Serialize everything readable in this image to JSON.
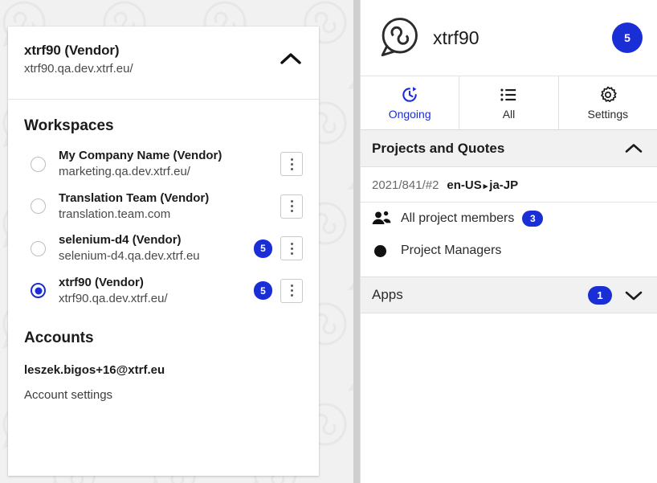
{
  "background": {
    "watermark_icon": "speech-bubble-infinity-logo",
    "color": "#f1f1f1"
  },
  "account_panel": {
    "current": {
      "name": "xtrf90 (Vendor)",
      "url": "xtrf90.qa.dev.xtrf.eu/",
      "collapse_icon": "chevron-up-icon"
    },
    "workspaces_heading": "Workspaces",
    "workspaces": [
      {
        "name": "My Company Name (Vendor)",
        "url": "marketing.qa.dev.xtrf.eu/",
        "selected": false,
        "badge": "",
        "menu_icon": "kebab-menu-icon"
      },
      {
        "name": "Translation Team (Vendor)",
        "url": "translation.team.com",
        "selected": false,
        "badge": "",
        "menu_icon": "kebab-menu-icon"
      },
      {
        "name": "selenium-d4 (Vendor)",
        "url": "selenium-d4.qa.dev.xtrf.eu",
        "selected": false,
        "badge": "5",
        "menu_icon": "kebab-menu-icon"
      },
      {
        "name": "xtrf90 (Vendor)",
        "url": "xtrf90.qa.dev.xtrf.eu/",
        "selected": true,
        "badge": "5",
        "menu_icon": "kebab-menu-icon"
      }
    ],
    "accounts_heading": "Accounts",
    "account_email": "leszek.bigos+16@xtrf.eu",
    "account_settings_label": "Account settings"
  },
  "right_panel": {
    "logo_icon": "speech-bubble-infinity-logo",
    "title": "xtrf90",
    "header_badge": "5",
    "tabs": [
      {
        "label": "Ongoing",
        "icon": "clock-history-icon",
        "active": true
      },
      {
        "label": "All",
        "icon": "list-icon",
        "active": false
      },
      {
        "label": "Settings",
        "icon": "gear-icon",
        "active": false
      }
    ],
    "projects_section": {
      "title": "Projects and Quotes",
      "collapse_icon": "chevron-up-icon",
      "project": {
        "id": "2021/841/#2",
        "source_language": "en-US",
        "arrow": "▸",
        "target_language": "ja-JP"
      },
      "members": [
        {
          "label": "All project members",
          "icon": "people-icon",
          "badge": "3"
        },
        {
          "label": "Project Managers",
          "icon": "filled-circle-icon",
          "badge": ""
        }
      ]
    },
    "apps_section": {
      "title": "Apps",
      "badge": "1",
      "expand_icon": "chevron-down-icon"
    }
  },
  "colors": {
    "accent_blue": "#1a2ed6",
    "panel_bg": "#ffffff",
    "section_bg": "#f1f1f1",
    "page_bg": "#f1f1f1"
  }
}
